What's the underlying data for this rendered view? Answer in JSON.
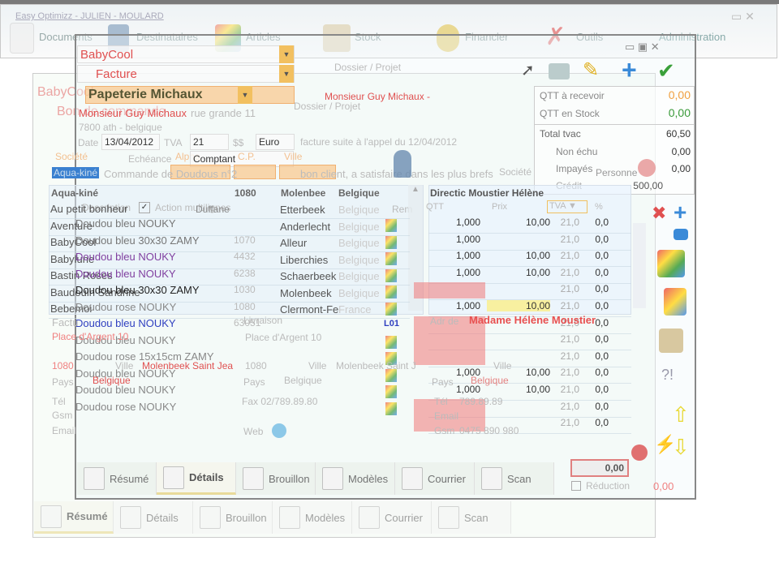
{
  "app": {
    "title": "Easy Optimizz - JULIEN - MOULARD",
    "toolbar": [
      "Documents",
      "Destinataires",
      "Articles",
      "Stock",
      "Financier",
      "Outils",
      "Administration"
    ]
  },
  "doc": {
    "company": "BabyCool",
    "doc_type": "Facture",
    "client": "Papeterie Michaux",
    "contact": "Monsieur Guy Michaux",
    "contact_header": "Monsieur Guy Michaux -",
    "dossier": "Dossier / Projet",
    "address1": "rue grande 11",
    "address2": "7800 ath - belgique",
    "date_label": "Date",
    "date": "13/04/2012",
    "tva_label": "TVA",
    "tva": "21",
    "ss_label": "$$",
    "currency": "Euro",
    "payment": "Comptant",
    "echeance_label": "Echéance",
    "societe_label": "Société",
    "alpha_label": "Alpha",
    "cp_label": "C.P.",
    "ville_label": "Ville",
    "note": "facture suite à l'appel du 12/04/2012",
    "ref": "Commande de Doudous n°2",
    "comment": "bon client, a satisfaire dans les plus brefs",
    "search_value": "Aqua-kiné",
    "back_company": "BabyCool",
    "back_doctype": "Bon de commande",
    "societe2": "Société",
    "personne": "Personne"
  },
  "summary": {
    "qtt_recevoir_label": "QTT à recevoir",
    "qtt_recevoir": "0,00",
    "qtt_stock_label": "QTT en Stock",
    "qtt_stock": "0,00",
    "total_label": "Total tvac",
    "total": "60,50",
    "non_echu_label": "Non échu",
    "non_echu": "0,00",
    "impayes_label": "Impayés",
    "impayes": "0,00",
    "credit_label": "Crédit",
    "credit": "500,00"
  },
  "colors": {
    "orange": "#f0a040",
    "green": "#3a9a3a",
    "red": "#e05050"
  },
  "companies": {
    "header": [
      "Aqua-kiné",
      "1080",
      "Molenbee",
      "Belgique"
    ],
    "rows": [
      [
        "Au petit bonheur",
        "",
        "Etterbeek",
        "Belgique"
      ],
      [
        "Aventure",
        "1070",
        "Anderlecht",
        "Belgique"
      ],
      [
        "BabyCool",
        "4432",
        "Alleur",
        "Belgique"
      ],
      [
        "Babylune",
        "6238",
        "Liberchies",
        "Belgique"
      ],
      [
        "Bastin Roses",
        "1030",
        "Schaerbeek",
        "Belgique"
      ],
      [
        "Baudouin Sandrine",
        "1080",
        "Molenbeek",
        "Belgique"
      ],
      [
        "Bebemoi",
        "63051",
        "Clermont-Fe",
        "France"
      ]
    ]
  },
  "lines": {
    "desc_label": "Description",
    "multi_label": "Action multilignes",
    "duff": "Duffane",
    "rem_label": "Rem",
    "items": [
      "Doudou bleu NOUKY",
      "Doudou bleu 30x30 ZAMY",
      "Doudou bleu NOUKY",
      "Doudou bleu NOUKY",
      "Doudou bleu 30x30 ZAMY",
      "Doudou rose NOUKY",
      "Doudou bleu NOUKY",
      "Doudou bleu NOUKY",
      "Doudou rose 15x15cm ZAMY",
      "Doudou bleu NOUKY",
      "Doudou bleu NOUKY",
      "Doudou rose NOUKY"
    ],
    "item_colors": [
      "#777",
      "#777",
      "#8040a0",
      "#8040a0",
      "#222",
      "#888",
      "#3040c0",
      "#888",
      "#888",
      "#888",
      "#888",
      "#888"
    ],
    "codes": [
      "",
      "",
      "",
      "",
      "",
      "",
      "L01",
      "",
      "",
      "",
      "",
      ""
    ]
  },
  "detail": {
    "header": "Directic Moustier  Hélène",
    "cols": [
      "QTT",
      "Prix",
      "TVA",
      "%"
    ],
    "rows": [
      [
        "1,000",
        "10,00",
        "21,0",
        "0,0"
      ],
      [
        "1,000",
        "",
        "21,0",
        "0,0"
      ],
      [
        "1,000",
        "10,00",
        "21,0",
        "0,0"
      ],
      [
        "1,000",
        "10,00",
        "21,0",
        "0,0"
      ],
      [
        "",
        "",
        "21,0",
        "0,0"
      ],
      [
        "1,000",
        "10,00",
        "21,0",
        "0,0"
      ],
      [
        "",
        "",
        "21,0",
        "0,0"
      ],
      [
        "",
        "",
        "21,0",
        "0,0"
      ],
      [
        "",
        "",
        "21,0",
        "0,0"
      ],
      [
        "1,000",
        "10,00",
        "21,0",
        "0,0"
      ],
      [
        "1,000",
        "10,00",
        "21,0",
        "0,0"
      ],
      [
        "",
        "",
        "21,0",
        "0,0"
      ],
      [
        "",
        "",
        "21,0",
        "0,0"
      ]
    ]
  },
  "addresses": {
    "facturation_label": "Factu",
    "fact_street": "Place d'Argent 10",
    "fact_cp": "1080",
    "ville_label": "Ville",
    "fact_city": "Molenbeek Saint Jea",
    "pays_label": "Pays",
    "fact_country": "Belgique",
    "tel_label": "Tél",
    "gsm_label": "Gsm",
    "email_label": "Email",
    "livraison_label": "Livraison",
    "liv_street": "Place d'Argent 10",
    "liv_cp": "1080",
    "liv_city": "Molenbeek Saint J",
    "liv_country": "Belgique",
    "fax": "Fax 02/789.89.80",
    "web_label": "Web",
    "adr_label": "Adr de",
    "adr_name": "Madame  Hélène Moustier",
    "adr_country": "Belgique",
    "adr_tel": "789.89.89",
    "adr_gsm": "0475 890 980"
  },
  "tabs": [
    "Résumé",
    "Détails",
    "Brouillon",
    "Modèles",
    "Courrier",
    "Scan"
  ],
  "footer": {
    "total": "0,00",
    "reduction_label": "Réduction",
    "reduction": "0,00"
  }
}
